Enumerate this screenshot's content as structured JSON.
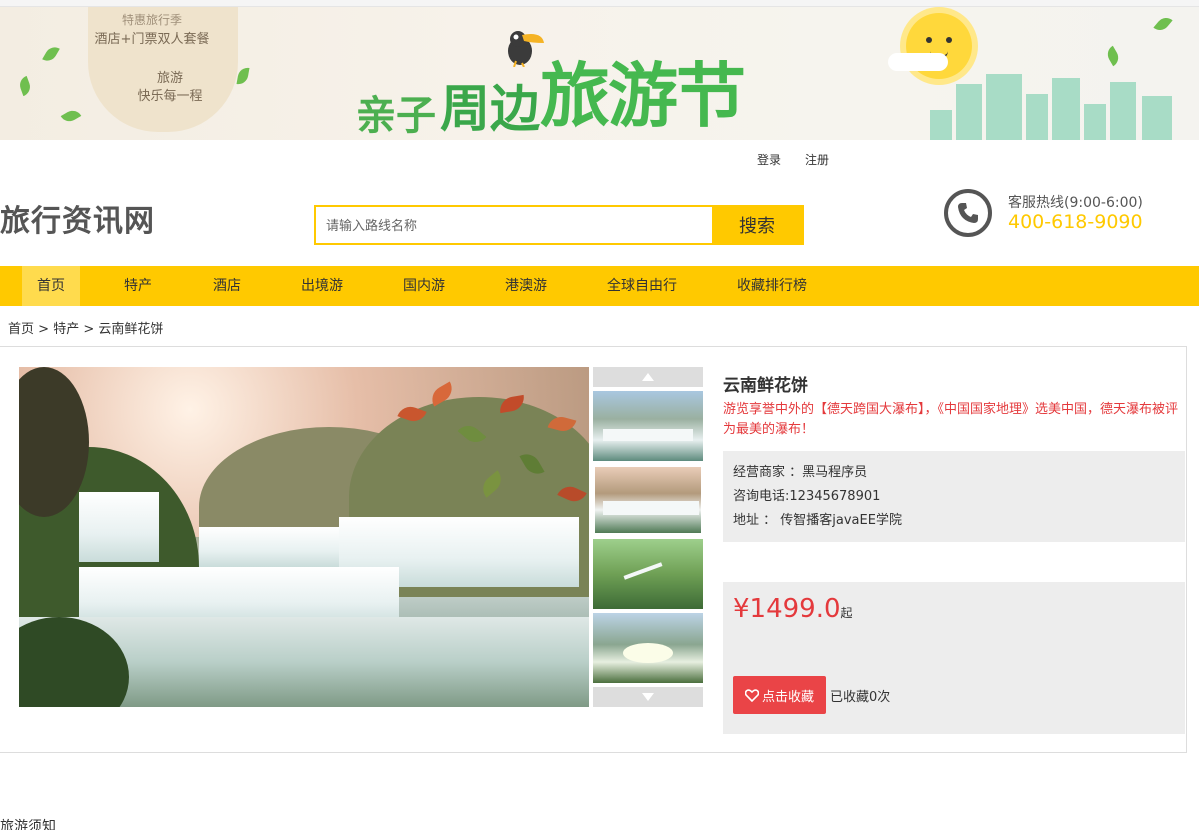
{
  "banner": {
    "badge_line1": "特惠旅行季",
    "badge_line2": "酒店+门票双人套餐",
    "badge_line3": "旅游",
    "badge_line4": "快乐每一程",
    "title_part1": "亲子",
    "title_part2": "周边",
    "title_part3": "旅游节"
  },
  "auth": {
    "login": "登录",
    "register": "注册"
  },
  "header": {
    "logo": "旅行资讯网",
    "search_placeholder": "请输入路线名称",
    "search_button": "搜索",
    "hotline_label": "客服热线(9:00-6:00)",
    "hotline_number": "400-618-9090"
  },
  "nav": {
    "items": [
      "首页",
      "特产",
      "酒店",
      "出境游",
      "国内游",
      "港澳游",
      "全球自由行",
      "收藏排行榜"
    ],
    "active_index": 0
  },
  "breadcrumb": {
    "home": "首页",
    "sep1": ">",
    "category": "特产",
    "sep2": ">",
    "current": "云南鲜花饼"
  },
  "product": {
    "title": "云南鲜花饼",
    "description": "游览享誉中外的【德天跨国大瀑布】，《中国国家地理》选美中国，德天瀑布被评为最美的瀑布！",
    "merchant_label": "经营商家",
    "merchant_value": "：黑马程序员",
    "phone_label": "咨询电话",
    "phone_value": "12345678901",
    "address_label": "地址",
    "address_value": "传智播客javaEE学院",
    "price": "¥1499.0",
    "price_suffix": "起",
    "favorite_button": "点击收藏",
    "favorite_count_text": "已收藏0次"
  },
  "section": {
    "notice_title": "旅游须知"
  },
  "colors": {
    "accent": "#ffc900",
    "price": "#e4393c",
    "favorite": "#ea4447"
  },
  "icons": [
    "phone-icon",
    "heart-icon",
    "arrow-up-icon",
    "arrow-down-icon"
  ]
}
